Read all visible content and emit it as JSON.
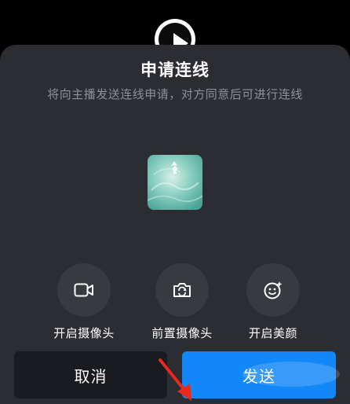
{
  "dialog": {
    "title": "申请连线",
    "subtitle": "将向主播发送连线申请，对方同意后可进行连线"
  },
  "options": [
    {
      "label": "开启摄像头",
      "icon": "camera-icon"
    },
    {
      "label": "前置摄像头",
      "icon": "flip-camera-icon"
    },
    {
      "label": "开启美颜",
      "icon": "beauty-face-icon"
    }
  ],
  "buttons": {
    "cancel_label": "取消",
    "send_label": "发送"
  },
  "colors": {
    "sheet_background": "#2b2d33",
    "option_circle": "#373a41",
    "cancel_background": "#191b20",
    "send_background": "#1287f8",
    "annotation_arrow": "#e8291c"
  }
}
